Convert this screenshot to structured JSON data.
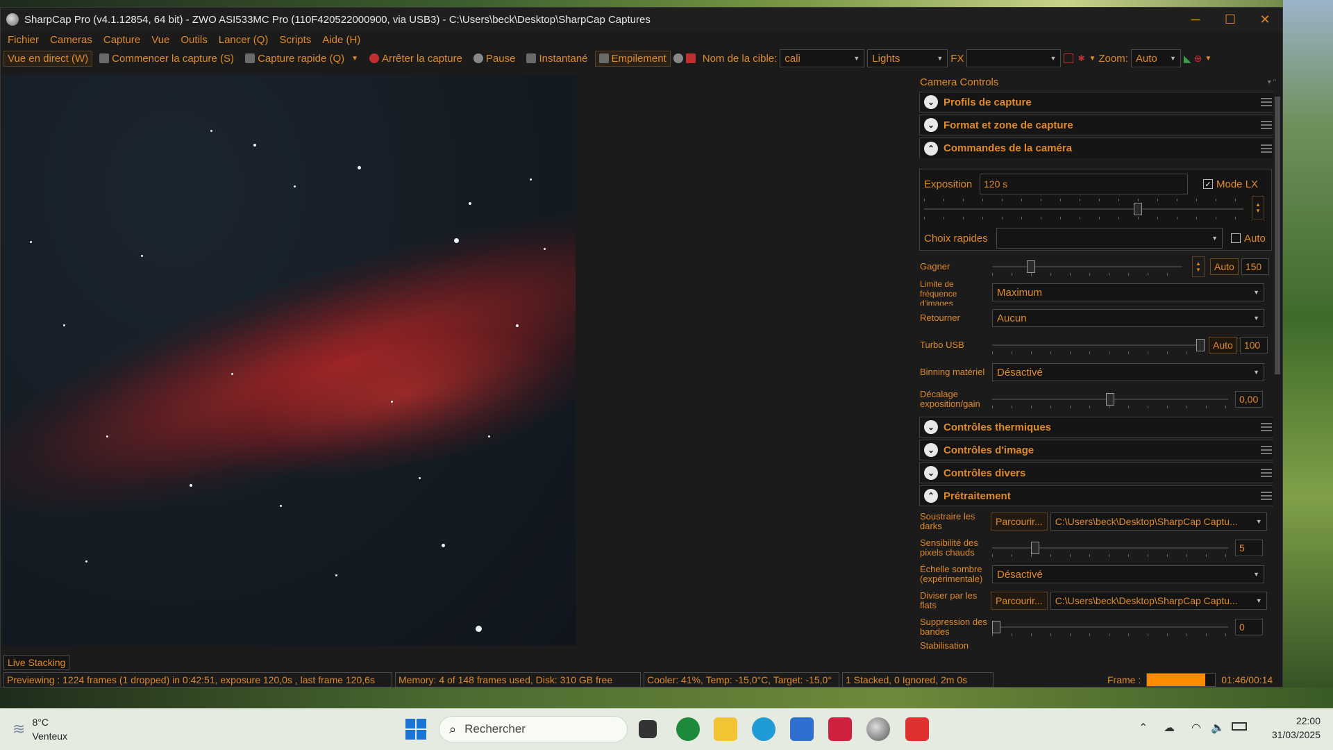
{
  "window": {
    "title": "SharpCap Pro (v4.1.12854, 64 bit) - ZWO ASI533MC Pro (110F420522000900, via USB3) - C:\\Users\\beck\\Desktop\\SharpCap Captures",
    "minimize": "─",
    "maximize": "☐",
    "close": "✕"
  },
  "menu": [
    "Fichier",
    "Cameras",
    "Capture",
    "Vue",
    "Outils",
    "Lancer (Q)",
    "Scripts",
    "Aide (H)"
  ],
  "toolbar": {
    "live_view": "Vue en direct (W)",
    "start_capture": "Commencer la capture (S)",
    "quick_capture": "Capture rapide (Q)",
    "stop_capture": "Arrêter la capture",
    "pause": "Pause",
    "snapshot": "Instantané",
    "stacking": "Empilement",
    "target_label": "Nom de la cible:",
    "target_value": "cali",
    "frame_type": "Lights",
    "fx_label": "FX",
    "fx_value": "",
    "zoom_label": "Zoom:",
    "zoom_value": "Auto"
  },
  "camera_controls": {
    "title": "Camera Controls",
    "sections": {
      "capture_profiles": "Profils de capture",
      "format_area": "Format et zone de capture",
      "camera_commands": "Commandes de la caméra",
      "thermal": "Contrôles thermiques",
      "image": "Contrôles d'image",
      "misc": "Contrôles divers",
      "preprocessing": "Prétraitement"
    },
    "exposure_label": "Exposition",
    "exposure_value": "120 s",
    "lx_mode_label": "Mode LX",
    "lx_mode_checked": true,
    "quick_choices_label": "Choix rapides",
    "quick_choices_value": "",
    "auto_label": "Auto",
    "gain_label": "Gagner",
    "gain_auto": "Auto",
    "gain_value": "150",
    "gain_level": 0.19,
    "frame_rate_label": "Limite de fréquence d'images",
    "frame_rate_value": "Maximum",
    "flip_label": "Retourner",
    "flip_value": "Aucun",
    "usb_turbo_label": "Turbo USB",
    "usb_turbo_auto": "Auto",
    "usb_turbo_value": "100",
    "usb_turbo_level": 1.0,
    "binning_label": "Binning matériel",
    "binning_value": "Désactivé",
    "exp_gain_offset_label": "Décalage exposition/gain",
    "exp_gain_offset_value": "0,00",
    "exp_gain_offset_level": 0.5,
    "dark_label": "Soustraire les darks",
    "browse_label": "Parcourir...",
    "dark_path": "C:\\Users\\beck\\Desktop\\SharpCap Captu...",
    "hot_pixel_label": "Sensibilité des pixels chauds",
    "hot_pixel_value": "5",
    "hot_pixel_level": 0.17,
    "dark_scale_label": "Échelle sombre (expérimentale)",
    "dark_scale_value": "Désactivé",
    "flat_label": "Diviser par les flats",
    "flat_path": "C:\\Users\\beck\\Desktop\\SharpCap Captu...",
    "banding_label": "Suppression des bandes",
    "banding_value": "0",
    "banding_level": 0.0,
    "stabilisation_label": "Stabilisation"
  },
  "live_stacking_label": "Live Stacking",
  "status": {
    "previewing": "Previewing : 1224 frames (1 dropped) in 0:42:51, exposure 120,0s , last frame 120,6s",
    "memory": "Memory: 4 of 148 frames used, Disk: 310 GB free",
    "cooler": "Cooler: 41%, Temp: -15,0°C, Target: -15,0°",
    "stacked": "1 Stacked, 0 Ignored, 2m 0s",
    "frame_label": "Frame :",
    "frame_progress": 0.85,
    "timer": "01:46/00:14"
  },
  "taskbar": {
    "weather_temp": "8°C",
    "weather_desc": "Venteux",
    "search_placeholder": "Rechercher",
    "time": "22:00",
    "date": "31/03/2025"
  },
  "colors": {
    "accent": "#e08a2a",
    "panel_bg": "#1b1b1b",
    "frame_bar": "#ff8c00"
  }
}
